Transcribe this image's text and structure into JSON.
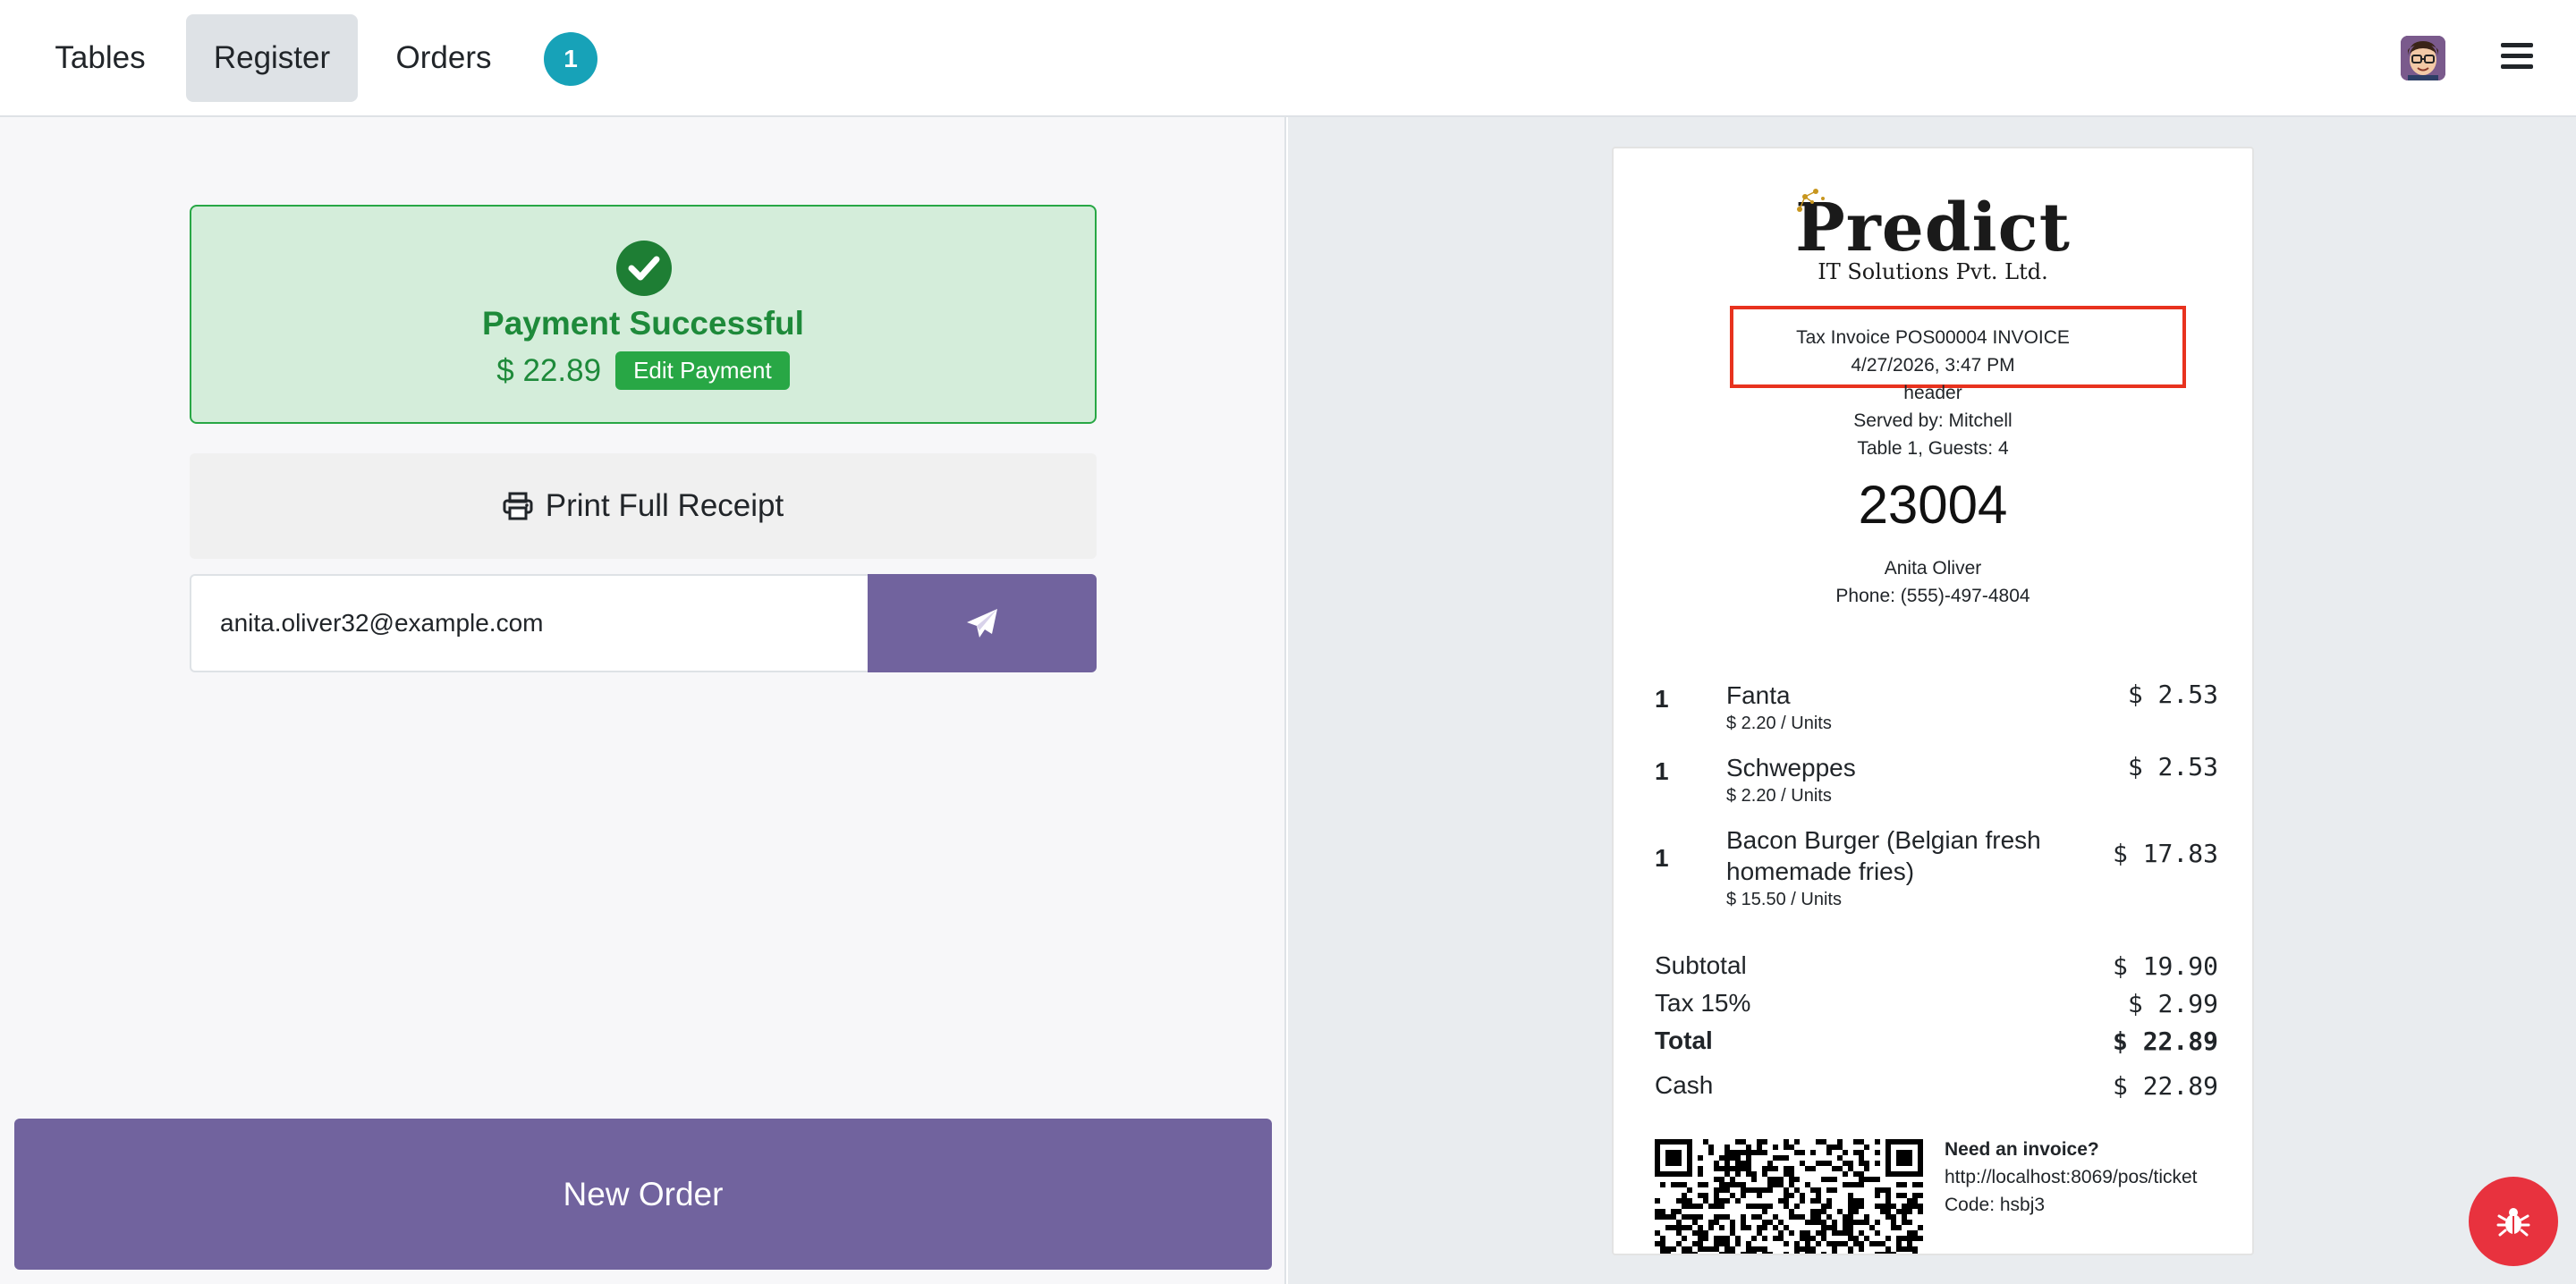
{
  "nav": {
    "tables_label": "Tables",
    "register_label": "Register",
    "orders_label": "Orders",
    "orders_badge": "1"
  },
  "payment": {
    "title": "Payment Successful",
    "amount": "$ 22.89",
    "edit_label": "Edit Payment"
  },
  "print_label": "Print Full Receipt",
  "email": {
    "value": "anita.oliver32@example.com"
  },
  "new_order_label": "New Order",
  "receipt": {
    "logo_main": "Predict",
    "logo_sub": "IT Solutions Pvt. Ltd.",
    "invoice_line": "Tax Invoice POS00004 INVOICE",
    "datetime": "4/27/2026, 3:47 PM",
    "header": "header",
    "served_by": "Served by: Mitchell",
    "table_guests": "Table 1, Guests: 4",
    "order_number": "23004",
    "customer_name": "Anita Oliver",
    "customer_phone": "Phone: (555)-497-4804",
    "items": [
      {
        "qty": "1",
        "name": "Fanta",
        "unit": "$ 2.20 / Units",
        "price": "$ 2.53"
      },
      {
        "qty": "1",
        "name": "Schweppes",
        "unit": "$ 2.20 / Units",
        "price": "$ 2.53"
      },
      {
        "qty": "1",
        "name": "Bacon Burger (Belgian fresh homemade fries)",
        "unit": "$ 15.50 / Units",
        "price": "$ 17.83"
      }
    ],
    "subtotal_label": "Subtotal",
    "subtotal": "$ 19.90",
    "tax_label": "Tax 15%",
    "tax": "$ 2.99",
    "total_label": "Total",
    "total": "$ 22.89",
    "cash_label": "Cash",
    "cash": "$ 22.89",
    "invoice_prompt": "Need an invoice?",
    "invoice_url": "http://localhost:8069/pos/ticket",
    "code": "Code: hsbj3"
  },
  "icons": {
    "menu": "hamburger-menu-icon",
    "print": "printer-icon",
    "send": "paper-plane-icon",
    "check": "check-circle-icon",
    "bug": "bug-icon"
  },
  "colors": {
    "success": "#28a745",
    "primary": "#71639e",
    "badge": "#17a2b8",
    "highlight": "#e8321e",
    "bug": "#e8323e"
  }
}
